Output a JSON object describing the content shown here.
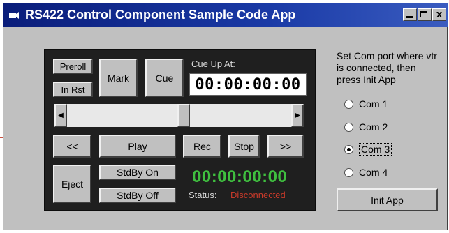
{
  "window": {
    "title": "RS422 Control Component Sample Code App",
    "close_glyph": "x"
  },
  "panel": {
    "preroll": "Preroll",
    "in_rst": "In Rst",
    "mark": "Mark",
    "cue": "Cue",
    "cue_up_label": "Cue Up At:",
    "cue_up_value": "00:00:00:00",
    "rewind": "<<",
    "play": "Play",
    "rec": "Rec",
    "stop": "Stop",
    "fast_forward": ">>",
    "eject": "Eject",
    "standby_on": "StdBy On",
    "standby_off": "StdBy Off",
    "timecode": "00:00:00:00",
    "status_label": "Status:",
    "status_value": "Disconnected",
    "scroll_left_glyph": "◀",
    "scroll_right_glyph": "▶"
  },
  "com": {
    "instructions": "Set Com port where vtr is connected, then press Init App",
    "ports": [
      "Com 1",
      "Com 2",
      "Com 3",
      "Com 4"
    ],
    "selected": "Com 3",
    "init_button": "Init App"
  },
  "colors": {
    "titlebar": "#0a1d7a",
    "panel_bg": "#1f1f1f",
    "timecode_green": "#3fbf3f",
    "status_red": "#c83a2a"
  },
  "icons": {
    "app": "app-icon",
    "minimize": "minimize-icon",
    "maximize": "maximize-icon",
    "close": "close-icon"
  }
}
